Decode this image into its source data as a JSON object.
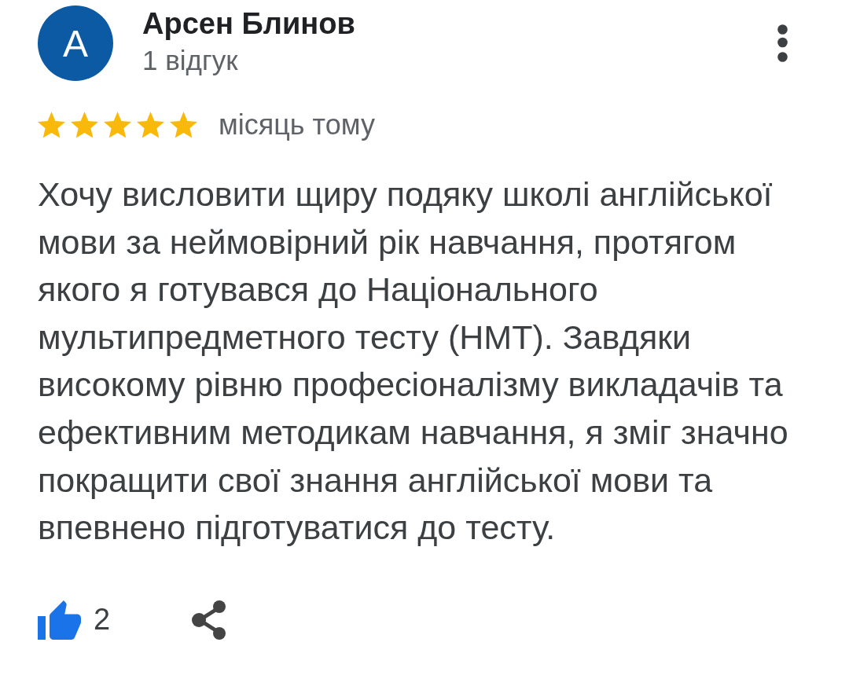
{
  "reviewer": {
    "avatar_letter": "А",
    "name": "Арсен Блинов",
    "review_count": "1 відгук"
  },
  "review": {
    "stars": 5,
    "date": "місяць тому",
    "text": "Хочу висловити щиру подяку школі англійської мови за неймовірний рік навчання, протягом якого я готувався до Національного мультипредметного тесту (НМТ). Завдяки високому рівню професіоналізму викладачів та ефективним методикам навчання, я зміг значно покращити свої знання англійської мови та впевнено підготуватися до тесту."
  },
  "actions": {
    "liked": true,
    "like_count": "2"
  }
}
